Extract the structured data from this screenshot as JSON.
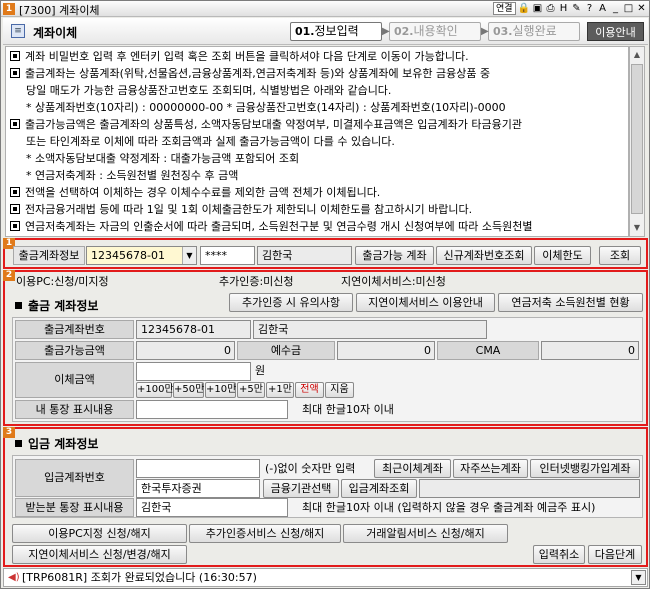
{
  "window": {
    "number": "1",
    "title": "[7300] 계좌이체",
    "controls": [
      "H",
      "?",
      "A"
    ],
    "link_label": "연결"
  },
  "header": {
    "title": "계좌이체",
    "steps": [
      {
        "num": "01.",
        "label": "정보입력"
      },
      {
        "num": "02.",
        "label": "내용확인"
      },
      {
        "num": "03.",
        "label": "실행완료"
      }
    ],
    "help_button": "이용안내"
  },
  "notice": {
    "lines": [
      {
        "bullet": true,
        "text": "계좌 비밀번호 입력 후 엔터키 입력 혹은 조회 버튼을 클릭하셔야 다음 단계로 이동이 가능합니다."
      },
      {
        "bullet": true,
        "text": "출금계좌는 상품계좌(위탁,선물옵션,금융상품계좌,연금저축계좌 등)와 상품계좌에 보유한 금융상품 중"
      },
      {
        "bullet": false,
        "text": "당일 매도가 가능한 금융상품잔고번호도 조회되며, 식별방법은 아래와 같습니다."
      },
      {
        "bullet": false,
        "text": "* 상품계좌번호(10자리) : 00000000-00 * 금융상품잔고번호(14자리) : 상품계좌번호(10자리)-0000"
      },
      {
        "bullet": true,
        "text": "출금가능금액은 출금계좌의 상품특성, 소액자동담보대출 약정여부, 미결제수표금액은 입금계좌가 타금융기관"
      },
      {
        "bullet": false,
        "text": "또는 타인계좌로 이체에 따라 조회금액과 실제 출금가능금액이 다를 수 있습니다."
      },
      {
        "bullet": false,
        "text": "* 소액자동담보대출 약정계좌 : 대출가능금액 포함되어 조회"
      },
      {
        "bullet": false,
        "text": "* 연금저축계좌 : 소득원천별 원천징수 후 금액"
      },
      {
        "bullet": true,
        "text": "전액을 선택하여 이체하는 경우 이체수수료를 제외한 금액 전체가 이체됩니다."
      },
      {
        "bullet": true,
        "text": "전자금융거래법 등에 따라 1일 및 1회 이체출금한도가 제한되니 이체한도를 참고하시기 바랍니다."
      },
      {
        "bullet": true,
        "text": "연금저축계좌는 자금의 인출순서에 따라 출금되며, 소득원천구분 및 연금수령 개시 신청여부에 따라 소득원천별"
      }
    ]
  },
  "section1": {
    "badge": "1",
    "account_label": "출금계좌정보",
    "account_value": "12345678-01",
    "password_mask": "****",
    "owner_name": "김한국",
    "buttons": [
      "출금가능 계좌",
      "신규계좌번호조회",
      "이체한도",
      "조회"
    ]
  },
  "section2": {
    "badge": "2",
    "info_pc": "이용PC:신청/미지정",
    "info_auth": "추가인증:미신청",
    "info_delay": "지연이체서비스:미신청",
    "title": "출금 계좌정보",
    "top_buttons": [
      "추가인증 시 유의사항",
      "지연이체서비스 이용안내",
      "연금저축 소득원천별 현황"
    ],
    "account_no_label": "출금계좌번호",
    "account_no_value": "12345678-01",
    "account_owner": "김한국",
    "available_label": "출금가능금액",
    "available_value": "0",
    "deposit_label": "예수금",
    "deposit_value": "0",
    "cma_label": "CMA",
    "cma_value": "0",
    "amount_label": "이체금액",
    "amount_unit": "원",
    "amount_buttons": [
      "+100만",
      "+50만",
      "+10만",
      "+5만",
      "+1만",
      "전액",
      "지움"
    ],
    "memo_label": "내 통장 표시내용",
    "memo_hint": "최대 한글10자 이내"
  },
  "section3": {
    "badge": "3",
    "title": "입금 계좌정보",
    "account_label": "입금계좌번호",
    "account_hint": "(-)없이 숫자만 입력",
    "account_buttons": [
      "최근이체계좌",
      "자주쓰는계좌",
      "인터넷뱅킹가입계좌"
    ],
    "bank_value": "한국투자증권",
    "bank_buttons": [
      "금융기관선택",
      "입금계좌조회"
    ],
    "memo_label": "받는분 통장 표시내용",
    "memo_value": "김한국",
    "memo_hint": "최대 한글10자 이내 (입력하지 않을 경우 출금계좌 예금주 표시)",
    "bottom_buttons": [
      "이용PC지정 신청/해지",
      "추가인증서비스 신청/해지",
      "거래알림서비스 신청/해지",
      "지연이체서비스 신청/변경/해지"
    ],
    "cancel_button": "입력취소",
    "next_button": "다음단계"
  },
  "status": {
    "message": "[TRP6081R] 조회가 완료되었습니다 (16:30:57)"
  }
}
